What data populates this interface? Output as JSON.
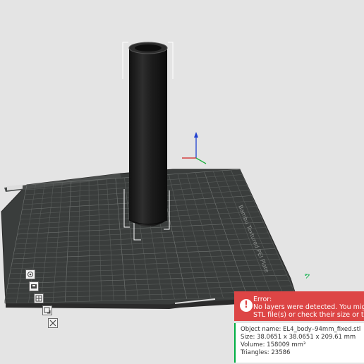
{
  "plate": {
    "label": "Bambu Textured PEI Plate",
    "brand_color": "#00ae42"
  },
  "error_toast": {
    "title": "Error:",
    "line1": "No layers were detected. You might wa",
    "line2": "STL file(s) or check their size or thickne",
    "icon": "!",
    "color": "#dd4545"
  },
  "object_info": {
    "name": "Object name: EL4_body–94mm_fixed.stl",
    "size": "Size: 38.0651 x 38.0651 x 209.61 mm",
    "volume": "Volume: 158009 mm³",
    "triangles": "Triangles: 23586"
  },
  "toolbar": {
    "icons": [
      "eye-icon",
      "layer-icon",
      "grid-icon",
      "add-plate-icon",
      "close-icon"
    ]
  }
}
